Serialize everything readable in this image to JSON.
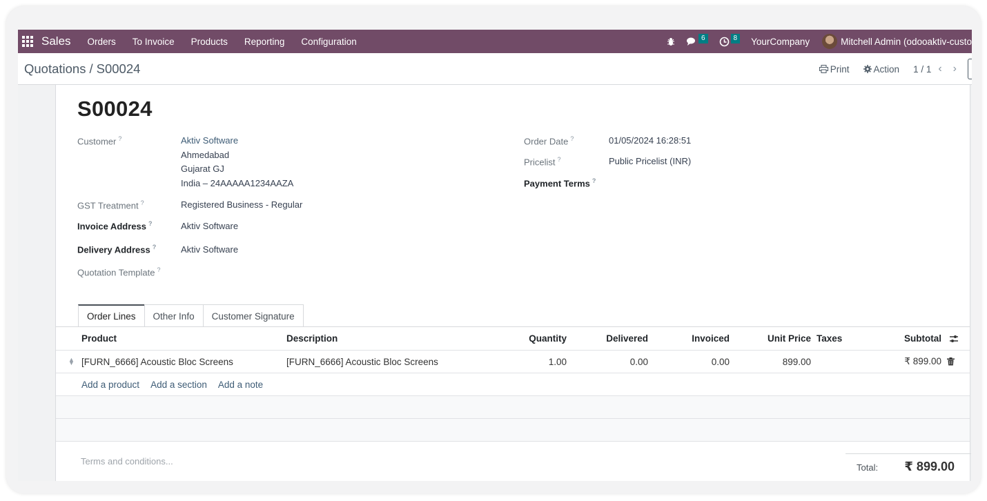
{
  "navbar": {
    "brand": "Sales",
    "menu": [
      "Orders",
      "To Invoice",
      "Products",
      "Reporting",
      "Configuration"
    ],
    "messages_count": "6",
    "activities_count": "8",
    "company": "YourCompany",
    "user": "Mitchell Admin (odooaktiv-custo"
  },
  "control_panel": {
    "breadcrumb_parent": "Quotations",
    "breadcrumb_sep": "/",
    "breadcrumb_current": "S00024",
    "print_label": "Print",
    "action_label": "Action",
    "pager": "1 / 1"
  },
  "form": {
    "title": "S00024",
    "customer_label": "Customer",
    "customer_name": "Aktiv Software",
    "customer_address": [
      "Ahmedabad",
      "Gujarat GJ",
      "India – 24AAAAA1234AAZA"
    ],
    "gst_label": "GST Treatment",
    "gst_value": "Registered Business - Regular",
    "invoice_address_label": "Invoice Address",
    "invoice_address_value": "Aktiv Software",
    "delivery_address_label": "Delivery Address",
    "delivery_address_value": "Aktiv Software",
    "template_label": "Quotation Template",
    "order_date_label": "Order Date",
    "order_date_value": "01/05/2024 16:28:51",
    "pricelist_label": "Pricelist",
    "pricelist_value": "Public Pricelist (INR)",
    "payment_terms_label": "Payment Terms",
    "help_mark": "?"
  },
  "tabs": [
    "Order Lines",
    "Other Info",
    "Customer Signature"
  ],
  "order_lines": {
    "headers": {
      "product": "Product",
      "description": "Description",
      "quantity": "Quantity",
      "delivered": "Delivered",
      "invoiced": "Invoiced",
      "unit_price": "Unit Price",
      "taxes": "Taxes",
      "subtotal": "Subtotal"
    },
    "rows": [
      {
        "product": "[FURN_6666] Acoustic Bloc Screens",
        "description": "[FURN_6666] Acoustic Bloc Screens",
        "quantity": "1.00",
        "delivered": "0.00",
        "invoiced": "0.00",
        "unit_price": "899.00",
        "taxes": "",
        "subtotal": "₹ 899.00"
      }
    ],
    "add_product": "Add a product",
    "add_section": "Add a section",
    "add_note": "Add a note"
  },
  "footer": {
    "terms_placeholder": "Terms and conditions...",
    "total_label": "Total:",
    "total_value": "₹ 899.00"
  },
  "colors": {
    "navbar": "#714b67",
    "badge": "#017e84",
    "link": "#3e5c76"
  }
}
